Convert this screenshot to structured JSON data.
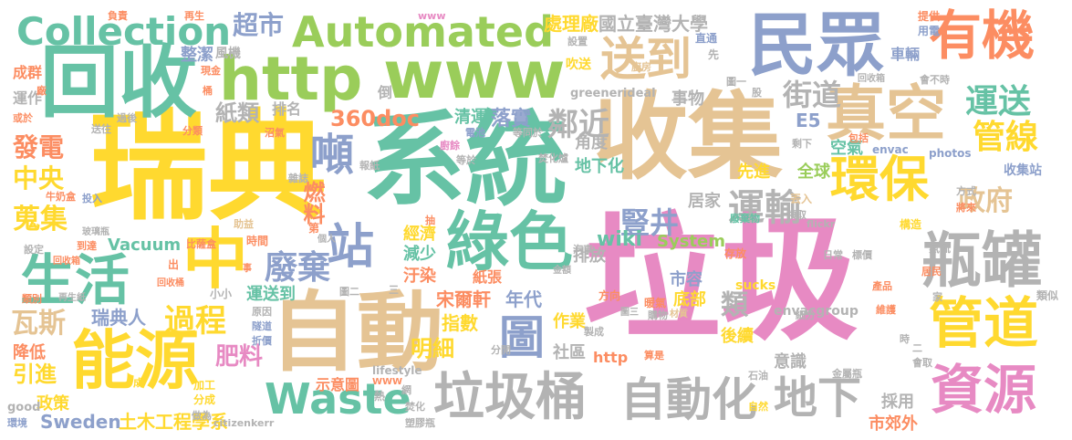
{
  "palette": {
    "green": "#9ACD5A",
    "teal": "#66C2A5",
    "pink": "#E78AC3",
    "yellow": "#FFD92F",
    "orange": "#FC8D62",
    "blue": "#8DA0CB",
    "tan": "#E5C494",
    "gray": "#B3B3B3"
  },
  "words": [
    {
      "text": "垃圾",
      "color": "#E78AC3",
      "vertical": false
    },
    {
      "text": "系統",
      "color": "#66C2A5",
      "vertical": false
    },
    {
      "text": "瑞典",
      "color": "#FFD92F",
      "vertical": false
    },
    {
      "text": "收集",
      "color": "#E5C494",
      "vertical": false
    },
    {
      "text": "自動",
      "color": "#E5C494",
      "vertical": false
    },
    {
      "text": "回收",
      "color": "#66C2A5",
      "vertical": false
    },
    {
      "text": "www",
      "color": "#9ACD5A",
      "vertical": false
    },
    {
      "text": "http",
      "color": "#9ACD5A",
      "vertical": false
    },
    {
      "text": "民眾",
      "color": "#8DA0CB",
      "vertical": false
    },
    {
      "text": "真空",
      "color": "#E5C494",
      "vertical": false
    },
    {
      "text": "垃圾桶",
      "color": "#B3B3B3",
      "vertical": false
    },
    {
      "text": "綠色",
      "color": "#66C2A5",
      "vertical": false
    },
    {
      "text": "能源",
      "color": "#FFD92F",
      "vertical": false
    },
    {
      "text": "生活",
      "color": "#66C2A5",
      "vertical": false
    },
    {
      "text": "中",
      "color": "#FFD92F",
      "vertical": false
    },
    {
      "text": "瓶罐",
      "color": "#B3B3B3",
      "vertical": false
    },
    {
      "text": "自動化",
      "color": "#B3B3B3",
      "vertical": false
    },
    {
      "text": "Automated",
      "color": "#9ACD5A",
      "vertical": false
    },
    {
      "text": "Collection",
      "color": "#66C2A5",
      "vertical": false
    },
    {
      "text": "Waste",
      "color": "#66C2A5",
      "vertical": false
    },
    {
      "text": "有機",
      "color": "#FC8D62",
      "vertical": false
    },
    {
      "text": "資源",
      "color": "#E78AC3",
      "vertical": false
    },
    {
      "text": "管道",
      "color": "#FFD92F",
      "vertical": false
    },
    {
      "text": "環保",
      "color": "#FFD92F",
      "vertical": false
    },
    {
      "text": "送到",
      "color": "#E5C494",
      "vertical": false
    },
    {
      "text": "站",
      "color": "#8DA0CB",
      "vertical": false
    },
    {
      "text": "噸",
      "color": "#8DA0CB",
      "vertical": false
    },
    {
      "text": "圖",
      "color": "#8DA0CB",
      "vertical": false
    },
    {
      "text": "地下",
      "color": "#B3B3B3",
      "vertical": false
    },
    {
      "text": "運送",
      "color": "#66C2A5",
      "vertical": false
    },
    {
      "text": "管線",
      "color": "#FFD92F",
      "vertical": false
    },
    {
      "text": "政府",
      "color": "#E5C494",
      "vertical": false
    },
    {
      "text": "運輸",
      "color": "#B3B3B3",
      "vertical": false
    },
    {
      "text": "廢棄",
      "color": "#8DA0CB",
      "vertical": false
    },
    {
      "text": "過程",
      "color": "#FFD92F",
      "vertical": false
    },
    {
      "text": "鄰近",
      "color": "#B3B3B3",
      "vertical": false
    },
    {
      "text": "街道",
      "color": "#B3B3B3",
      "vertical": false
    },
    {
      "text": "豎井",
      "color": "#8DA0CB",
      "vertical": false
    },
    {
      "text": "燃料",
      "color": "#FC8D62",
      "vertical": false
    },
    {
      "text": "肥料",
      "color": "#E78AC3",
      "vertical": false
    },
    {
      "text": "發電",
      "color": "#FC8D62",
      "vertical": false
    },
    {
      "text": "中央",
      "color": "#FFD92F",
      "vertical": false
    },
    {
      "text": "蒐集",
      "color": "#FFD92F",
      "vertical": false
    },
    {
      "text": "瓦斯",
      "color": "#E5C494",
      "vertical": false
    },
    {
      "text": "引進",
      "color": "#FFD92F",
      "vertical": false
    },
    {
      "text": "降低",
      "color": "#FC8D62",
      "vertical": false
    },
    {
      "text": "政策",
      "color": "#FFD92F",
      "vertical": false
    },
    {
      "text": "超市",
      "color": "#8DA0CB",
      "vertical": false
    },
    {
      "text": "紙類",
      "color": "#B3B3B3",
      "vertical": false
    },
    {
      "text": "360doc",
      "color": "#FC8D62",
      "vertical": false
    },
    {
      "text": "瑞典人",
      "color": "#8DA0CB",
      "vertical": false
    },
    {
      "text": "Vacuum",
      "color": "#66C2A5",
      "vertical": false
    },
    {
      "text": "Sweden",
      "color": "#8DA0CB",
      "vertical": false
    },
    {
      "text": "土木工程學系",
      "color": "#FFD92F",
      "vertical": false
    },
    {
      "text": "明細",
      "color": "#FFD92F",
      "vertical": false
    },
    {
      "text": "類",
      "color": "#B3B3B3",
      "vertical": false
    },
    {
      "text": "指數",
      "color": "#FFD92F",
      "vertical": false
    },
    {
      "text": "wiki",
      "color": "#66C2A5",
      "vertical": false
    },
    {
      "text": "System",
      "color": "#9ACD5A",
      "vertical": false
    },
    {
      "text": "年代",
      "color": "#8DA0CB",
      "vertical": false
    },
    {
      "text": "宋爾軒",
      "color": "#FC8D62",
      "vertical": false
    },
    {
      "text": "國立臺灣大學",
      "color": "#B3B3B3",
      "vertical": false
    },
    {
      "text": "處理廠",
      "color": "#FFD92F",
      "vertical": false
    },
    {
      "text": "空氣",
      "color": "#66C2A5",
      "vertical": false
    },
    {
      "text": "全球",
      "color": "#9ACD5A",
      "vertical": false
    },
    {
      "text": "先進",
      "color": "#FFD92F",
      "vertical": false
    },
    {
      "text": "收集站",
      "color": "#8DA0CB",
      "vertical": false
    },
    {
      "text": "E5",
      "color": "#8DA0CB",
      "vertical": false
    },
    {
      "text": "落實",
      "color": "#8DA0CB",
      "vertical": false
    },
    {
      "text": "清運",
      "color": "#66C2A5",
      "vertical": false
    },
    {
      "text": "事物",
      "color": "#B3B3B3",
      "vertical": false
    },
    {
      "text": "角度",
      "color": "#B3B3B3",
      "vertical": false
    },
    {
      "text": "地下化",
      "color": "#66C2A5",
      "vertical": false
    },
    {
      "text": "排放",
      "color": "#B3B3B3",
      "vertical": false
    },
    {
      "text": "居家",
      "color": "#B3B3B3",
      "vertical": false
    },
    {
      "text": "市容",
      "color": "#8DA0CB",
      "vertical": false
    },
    {
      "text": "底部",
      "color": "#FFD92F",
      "vertical": false
    },
    {
      "text": "後續",
      "color": "#FFD92F",
      "vertical": false
    },
    {
      "text": "意識",
      "color": "#B3B3B3",
      "vertical": false
    },
    {
      "text": "採用",
      "color": "#B3B3B3",
      "vertical": false
    },
    {
      "text": "市郊外",
      "color": "#FC8D62",
      "vertical": false
    },
    {
      "text": "作業",
      "color": "#FFD92F",
      "vertical": false
    },
    {
      "text": "社區",
      "color": "#B3B3B3",
      "vertical": false
    },
    {
      "text": "http",
      "color": "#FC8D62",
      "vertical": false
    },
    {
      "text": "運送到",
      "color": "#66C2A5",
      "vertical": false
    },
    {
      "text": "經濟",
      "color": "#FFD92F",
      "vertical": false
    },
    {
      "text": "減少",
      "color": "#66C2A5",
      "vertical": false
    },
    {
      "text": "汙染",
      "color": "#FC8D62",
      "vertical": false
    },
    {
      "text": "紙張",
      "color": "#FC8D62",
      "vertical": false
    },
    {
      "text": "示意圖",
      "color": "#FC8D62",
      "vertical": false
    },
    {
      "text": "整潔",
      "color": "#8DA0CB",
      "vertical": false
    },
    {
      "text": "運作",
      "color": "#B3B3B3",
      "vertical": false
    },
    {
      "text": "成群",
      "color": "#FC8D62",
      "vertical": false
    },
    {
      "text": "排名",
      "color": "#B3B3B3",
      "vertical": false
    },
    {
      "text": "倒",
      "color": "#B3B3B3",
      "vertical": false
    },
    {
      "text": "車輛",
      "color": "#8DA0CB",
      "vertical": false
    },
    {
      "text": "風機",
      "color": "#B3B3B3",
      "vertical": false
    },
    {
      "text": "吹送",
      "color": "#FFD92F",
      "vertical": false
    },
    {
      "text": "greenerideal",
      "color": "#B3B3B3",
      "vertical": false
    },
    {
      "text": "sucks",
      "color": "#FFD92F",
      "vertical": false
    },
    {
      "text": "envacgroup",
      "color": "#B3B3B3",
      "vertical": false
    },
    {
      "text": "lifestyle",
      "color": "#B3B3B3",
      "vertical": false
    },
    {
      "text": "citizenkerr",
      "color": "#B3B3B3",
      "vertical": false
    },
    {
      "text": "good",
      "color": "#B3B3B3",
      "vertical": false
    },
    {
      "text": "環境",
      "color": "#8DA0CB",
      "vertical": false
    },
    {
      "text": "加工",
      "color": "#FFD92F",
      "vertical": false
    },
    {
      "text": "分成",
      "color": "#FFD92F",
      "vertical": false
    },
    {
      "text": "做為",
      "color": "#B3B3B3",
      "vertical": false
    },
    {
      "text": "塑膠瓶",
      "color": "#B3B3B3",
      "vertical": false
    },
    {
      "text": "焚化",
      "color": "#B3B3B3",
      "vertical": false
    },
    {
      "text": "網",
      "color": "#B3B3B3",
      "vertical": false
    },
    {
      "text": "熱",
      "color": "#B3B3B3",
      "vertical": false
    },
    {
      "text": "分開",
      "color": "#B3B3B3",
      "vertical": false
    },
    {
      "text": "算是",
      "color": "#FC8D62",
      "vertical": false
    },
    {
      "text": "石油",
      "color": "#B3B3B3",
      "vertical": false
    },
    {
      "text": "自然",
      "color": "#FFD92F",
      "vertical": false
    },
    {
      "text": "金屬瓶",
      "color": "#B3B3B3",
      "vertical": false
    },
    {
      "text": "會取",
      "color": "#B3B3B3",
      "vertical": false
    },
    {
      "text": "類似",
      "color": "#B3B3B3",
      "vertical": false
    },
    {
      "text": "家",
      "color": "#B3B3B3",
      "vertical": false
    },
    {
      "text": "產品",
      "color": "#FC8D62",
      "vertical": false
    },
    {
      "text": "維護",
      "color": "#FC8D62",
      "vertical": false
    },
    {
      "text": "細分",
      "color": "#B3B3B3",
      "vertical": false
    },
    {
      "text": "暖氣",
      "color": "#FC8D62",
      "vertical": false
    },
    {
      "text": "方向",
      "color": "#FC8D62",
      "vertical": false
    },
    {
      "text": "居民",
      "color": "#FC8D62",
      "vertical": false
    },
    {
      "text": "氣流",
      "color": "#B3B3B3",
      "vertical": false
    },
    {
      "text": "構造",
      "color": "#FFD92F",
      "vertical": false
    },
    {
      "text": "標價",
      "color": "#B3B3B3",
      "vertical": false
    },
    {
      "text": "日常",
      "color": "#B3B3B3",
      "vertical": false
    },
    {
      "text": "方式",
      "color": "#B3B3B3",
      "vertical": false
    },
    {
      "text": "將來",
      "color": "#FC8D62",
      "vertical": false
    },
    {
      "text": "丟入",
      "color": "#E5C494",
      "vertical": false
    },
    {
      "text": "領取",
      "color": "#B3B3B3",
      "vertical": false
    },
    {
      "text": "flickr",
      "color": "#B3B3B3",
      "vertical": false
    },
    {
      "text": "包括",
      "color": "#FC8D62",
      "vertical": false
    },
    {
      "text": "envac",
      "color": "#8DA0CB",
      "vertical": false
    },
    {
      "text": "photos",
      "color": "#8DA0CB",
      "vertical": false
    },
    {
      "text": "剩下",
      "color": "#B3B3B3",
      "vertical": false
    },
    {
      "text": "會不時",
      "color": "#B3B3B3",
      "vertical": false
    },
    {
      "text": "回收箱",
      "color": "#B3B3B3",
      "vertical": false
    },
    {
      "text": "股",
      "color": "#B3B3B3",
      "vertical": false
    },
    {
      "text": "圖一",
      "color": "#B3B3B3",
      "vertical": false
    },
    {
      "text": "提供",
      "color": "#FC8D62",
      "vertical": false
    },
    {
      "text": "用電",
      "color": "#8DA0CB",
      "vertical": false
    },
    {
      "text": "直通",
      "color": "#8DA0CB",
      "vertical": false
    },
    {
      "text": "先",
      "color": "#B3B3B3",
      "vertical": false
    },
    {
      "text": "設置",
      "color": "#B3B3B3",
      "vertical": false
    },
    {
      "text": "廚房",
      "color": "#E5C494",
      "vertical": false
    },
    {
      "text": "www",
      "color": "#E78AC3",
      "vertical": false
    },
    {
      "text": "負責",
      "color": "#FC8D62",
      "vertical": false
    },
    {
      "text": "再生",
      "color": "#FC8D62",
      "vertical": false
    },
    {
      "text": "現金",
      "color": "#FC8D62",
      "vertical": false
    },
    {
      "text": "桶",
      "color": "#FC8D62",
      "vertical": false
    },
    {
      "text": "廠",
      "color": "#FC8D62",
      "vertical": false
    },
    {
      "text": "過後",
      "color": "#B3B3B3",
      "vertical": false
    },
    {
      "text": "或於",
      "color": "#FC8D62",
      "vertical": false
    },
    {
      "text": "送往",
      "color": "#B3B3B3",
      "vertical": false
    },
    {
      "text": "分類",
      "color": "#FC8D62",
      "vertical": false
    },
    {
      "text": "沼氣",
      "color": "#FC8D62",
      "vertical": false
    },
    {
      "text": "電池",
      "color": "#8DA0CB",
      "vertical": false
    },
    {
      "text": "廚餘",
      "color": "#E78AC3",
      "vertical": false
    },
    {
      "text": "等同於",
      "color": "#B3B3B3",
      "vertical": false
    },
    {
      "text": "焚化爐",
      "color": "#B3B3B3",
      "vertical": false
    },
    {
      "text": "報紙",
      "color": "#B3B3B3",
      "vertical": false
    },
    {
      "text": "等於",
      "color": "#B3B3B3",
      "vertical": false
    },
    {
      "text": "雜誌",
      "color": "#B3B3B3",
      "vertical": false
    },
    {
      "text": "牛奶盒",
      "color": "#FC8D62",
      "vertical": false
    },
    {
      "text": "投入",
      "color": "#8DA0CB",
      "vertical": false
    },
    {
      "text": "玻璃瓶",
      "color": "#B3B3B3",
      "vertical": false
    },
    {
      "text": "助益",
      "color": "#E5C494",
      "vertical": false
    },
    {
      "text": "比薩盒",
      "color": "#FC8D62",
      "vertical": false
    },
    {
      "text": "第",
      "color": "#FC8D62",
      "vertical": false
    },
    {
      "text": "時間",
      "color": "#FC8D62",
      "vertical": false
    },
    {
      "text": "個人",
      "color": "#B3B3B3",
      "vertical": false
    },
    {
      "text": "抽",
      "color": "#FC8D62",
      "vertical": false
    },
    {
      "text": "到達",
      "color": "#FC8D62",
      "vertical": false
    },
    {
      "text": "設定",
      "color": "#B3B3B3",
      "vertical": false
    },
    {
      "text": "回收箱",
      "color": "#FC8D62",
      "vertical": false
    },
    {
      "text": "出",
      "color": "#FC8D62",
      "vertical": false
    },
    {
      "text": "小小",
      "color": "#B3B3B3",
      "vertical": false
    },
    {
      "text": "事",
      "color": "#FC8D62",
      "vertical": false
    },
    {
      "text": "類別",
      "color": "#FC8D62",
      "vertical": false
    },
    {
      "text": "再生紙",
      "color": "#B3B3B3",
      "vertical": false
    },
    {
      "text": "回收桶",
      "color": "#FC8D62",
      "vertical": false
    },
    {
      "text": "圖二",
      "color": "#B3B3B3",
      "vertical": false
    },
    {
      "text": "三",
      "color": "#B3B3B3",
      "vertical": false
    },
    {
      "text": "原因",
      "color": "#B3B3B3",
      "vertical": false
    },
    {
      "text": "隧道",
      "color": "#8DA0CB",
      "vertical": false
    },
    {
      "text": "折價",
      "color": "#8DA0CB",
      "vertical": false
    },
    {
      "text": "成",
      "color": "#FFD92F",
      "vertical": false
    },
    {
      "text": "汽車",
      "color": "#B3B3B3",
      "vertical": false
    },
    {
      "text": "金額",
      "color": "#B3B3B3",
      "vertical": false
    },
    {
      "text": "存放",
      "color": "#FC8D62",
      "vertical": false
    },
    {
      "text": "廢棄物",
      "color": "#66C2A5",
      "vertical": false
    },
    {
      "text": "購物",
      "color": "#B3B3B3",
      "vertical": false
    },
    {
      "text": "圖三",
      "color": "#B3B3B3",
      "vertical": false
    },
    {
      "text": "製成",
      "color": "#B3B3B3",
      "vertical": false
    },
    {
      "text": "材質",
      "color": "#E5C494",
      "vertical": false
    },
    {
      "text": "二",
      "color": "#B3B3B3",
      "vertical": false
    },
    {
      "text": "時",
      "color": "#B3B3B3",
      "vertical": false
    },
    {
      "text": "WWW",
      "color": "#FC8D62",
      "vertical": false
    }
  ]
}
